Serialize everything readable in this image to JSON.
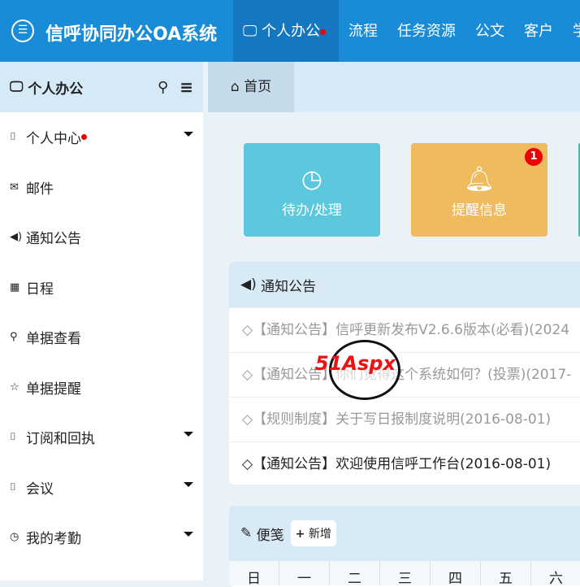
{
  "header": {
    "title": "信呼协同办公OA系统",
    "nav": [
      "个人办公",
      "流程",
      "任务资源",
      "公文",
      "客户",
      "学"
    ]
  },
  "sidebar": {
    "title": "个人办公",
    "items": [
      {
        "label": "个人中心",
        "icon": "bookmark-icon",
        "caret": true,
        "dot": true
      },
      {
        "label": "邮件",
        "icon": "envelope-icon"
      },
      {
        "label": "通知公告",
        "icon": "volume-icon"
      },
      {
        "label": "日程",
        "icon": "calendar-icon"
      },
      {
        "label": "单据查看",
        "icon": "search-icon"
      },
      {
        "label": "单据提醒",
        "icon": "star-icon"
      },
      {
        "label": "订阅和回执",
        "icon": "bookmark-icon",
        "caret": true
      },
      {
        "label": "会议",
        "icon": "bookmark-icon",
        "caret": true
      },
      {
        "label": "我的考勤",
        "icon": "clock-icon",
        "caret": true
      }
    ]
  },
  "breadcrumb": {
    "home": "首页"
  },
  "tiles": [
    {
      "label": "待办/处理",
      "color": "#5bc8de"
    },
    {
      "label": "提醒信息",
      "color": "#f0ba5e",
      "badge": "1"
    }
  ],
  "notices": {
    "title": "通知公告",
    "items": [
      "◇【通知公告】信呼更新发布V2.6.6版本(必看)(2024",
      "◇【通知公告】你们觉得这个系统如何？(投票)(2017-",
      "◇【规则制度】关于写日报制度说明(2016-08-01)",
      "◇【通知公告】欢迎使用信呼工作台(2016-08-01)"
    ]
  },
  "memo": {
    "title": "便笺",
    "add": "新增",
    "weekdays": [
      "日",
      "一",
      "二",
      "三",
      "四",
      "五",
      "六"
    ]
  },
  "watermark": "51Aspx"
}
